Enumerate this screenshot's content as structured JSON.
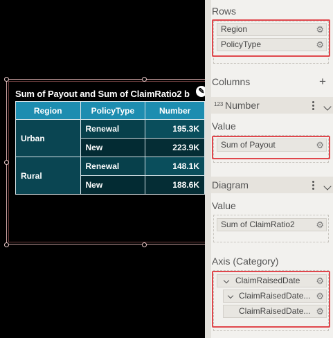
{
  "visual": {
    "title": "Sum of Payout and Sum of ClaimRatio2 b",
    "badge_glyph": "✎",
    "table": {
      "headers": [
        "Region",
        "PolicyType",
        "Number"
      ],
      "rows": [
        {
          "region": "Urban",
          "items": [
            {
              "type": "Renewal",
              "value": "195.3K"
            },
            {
              "type": "New",
              "value": "223.9K"
            }
          ]
        },
        {
          "region": "Rural",
          "items": [
            {
              "type": "Renewal",
              "value": "148.1K"
            },
            {
              "type": "New",
              "value": "188.6K"
            }
          ]
        }
      ]
    }
  },
  "panel": {
    "rows": {
      "title": "Rows",
      "fields": [
        "Region",
        "PolicyType"
      ]
    },
    "columns": {
      "title": "Columns",
      "add_glyph": "+"
    },
    "number": {
      "icon_text": "123",
      "label": "Number"
    },
    "value1": {
      "title": "Value",
      "fields": [
        "Sum of Payout"
      ]
    },
    "diagram": {
      "title": "Diagram"
    },
    "value2": {
      "title": "Value",
      "fields": [
        "Sum of ClaimRatio2"
      ]
    },
    "axis": {
      "title": "Axis (Category)",
      "fields": [
        "ClaimRaisedDate",
        "ClaimRaisedDate...",
        "ClaimRaisedDate..."
      ]
    },
    "gear_glyph": "⚙"
  }
}
